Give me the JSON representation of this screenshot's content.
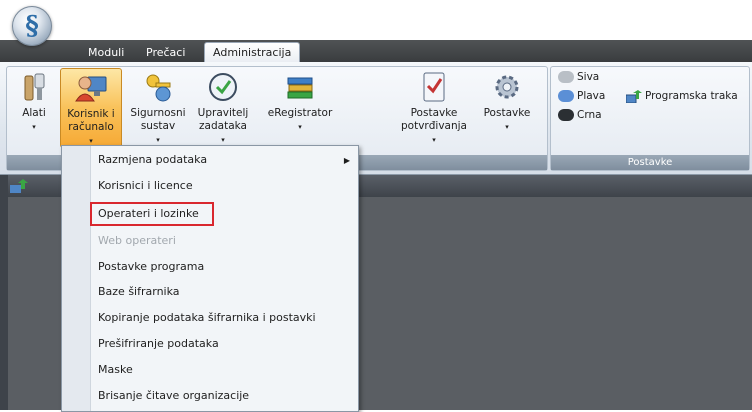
{
  "tabs": [
    "Moduli",
    "Prečaci",
    "Administracija"
  ],
  "active_tab": "Administracija",
  "ribbon": {
    "buttons": [
      {
        "label": "Alati",
        "caret": "▾",
        "icon": "tools-icon"
      },
      {
        "label": "Korisnik i\nračunalo",
        "caret": "▾",
        "icon": "user-computer-icon"
      },
      {
        "label": "Sigurnosni\nsustav",
        "caret": "▾",
        "icon": "security-key-icon"
      },
      {
        "label": "Upravitelj\nzadataka",
        "caret": "▾",
        "icon": "task-manager-clock-icon"
      },
      {
        "label": "eRegistrator",
        "caret": "▾",
        "icon": "books-icon"
      },
      {
        "label": "Postavke\npotvrđivanja",
        "caret": "▾",
        "icon": "checklist-icon"
      },
      {
        "label": "Postavke",
        "caret": "▾",
        "icon": "gear-icon"
      }
    ],
    "theme_options": [
      {
        "label": "Siva",
        "color": "#b9bfc6"
      },
      {
        "label": "Plava",
        "color": "#5b8fd6"
      },
      {
        "label": "Crna",
        "color": "#2b2f33"
      }
    ],
    "programska_traka": "Programska traka",
    "group_label": "Postavke"
  },
  "menu": {
    "items": [
      {
        "label": "Razmjena podataka",
        "submenu": true,
        "disabled": false
      },
      {
        "label": "Korisnici i licence",
        "submenu": false,
        "disabled": false
      },
      {
        "label": "Operateri i lozinke",
        "submenu": false,
        "disabled": false
      },
      {
        "label": "Web operateri",
        "submenu": false,
        "disabled": true
      },
      {
        "label": "Postavke programa",
        "submenu": false,
        "disabled": false
      },
      {
        "label": "Baze šifrarnika",
        "submenu": false,
        "disabled": false
      },
      {
        "label": "Kopiranje podataka šifrarnika i postavki",
        "submenu": false,
        "disabled": false
      },
      {
        "label": "Prešifriranje podataka",
        "submenu": false,
        "disabled": false
      },
      {
        "label": "Maske",
        "submenu": false,
        "disabled": false
      },
      {
        "label": "Brisanje čitave organizacije",
        "submenu": false,
        "disabled": false
      }
    ],
    "submenu_arrow": "▶"
  },
  "colors": {
    "highlight": "#d9272e",
    "pressed": "#f9c25a"
  }
}
